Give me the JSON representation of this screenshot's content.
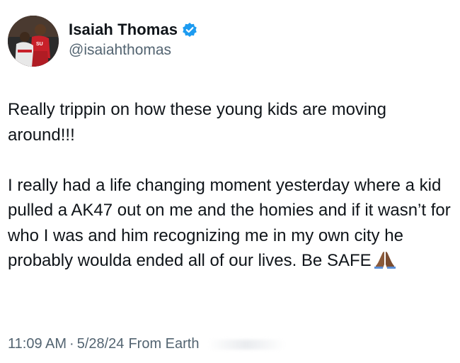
{
  "author": {
    "display_name": "Isaiah Thomas",
    "handle": "@isaiahthomas",
    "verified": true,
    "avatar_icon": "profile-photo"
  },
  "tweet": {
    "paragraphs": [
      "Really trippin on how these young kids are moving around!!!",
      "I really had a life changing moment yesterday where a kid pulled a AK47 out on me and the homies and if it wasn’t for who I was and him recognizing me in my own city he probably woulda ended all of our lives. Be SAFE"
    ],
    "emoji_icon": "folded-hands-icon"
  },
  "meta": {
    "time": "11:09 AM",
    "separator": "·",
    "date": "5/28/24",
    "location": "From Earth"
  },
  "colors": {
    "text": "#0f1419",
    "secondary_text": "#536471",
    "verified_blue": "#1d9bf0"
  }
}
